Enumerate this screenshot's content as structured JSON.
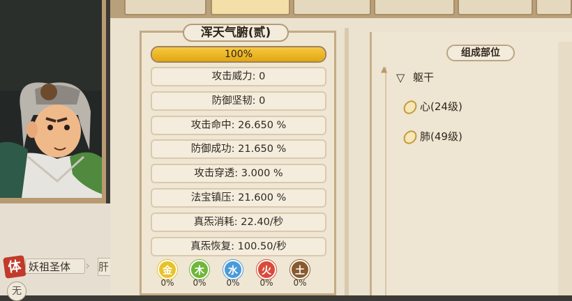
{
  "character": {
    "body_tag": "体",
    "body_name": "妖祖圣体",
    "next_tag": "肝",
    "small_circle": "无"
  },
  "stat_panel": {
    "title": "浑天气腑(贰)",
    "progress_text": "100%",
    "progress_value": 1.0,
    "stats": [
      "攻击威力: 0",
      "防御坚韧: 0",
      "攻击命中: 26.650 %",
      "防御成功: 21.650 %",
      "攻击穿透: 3.000 %",
      "法宝镇压: 21.600 %",
      "真炁消耗: 22.40/秒",
      "真炁恢复: 100.50/秒"
    ],
    "elements": [
      {
        "name": "金",
        "pct": "0%",
        "color": "#e8c22a"
      },
      {
        "name": "木",
        "pct": "0%",
        "color": "#6fb63a"
      },
      {
        "name": "水",
        "pct": "0%",
        "color": "#4a9ad8"
      },
      {
        "name": "火",
        "pct": "0%",
        "color": "#d94a3a"
      },
      {
        "name": "土",
        "pct": "0%",
        "color": "#8a5a2e"
      }
    ]
  },
  "parts_panel": {
    "title": "组成部位",
    "root": "躯干",
    "organs": [
      "心(24级)",
      "肺(49级)"
    ]
  }
}
